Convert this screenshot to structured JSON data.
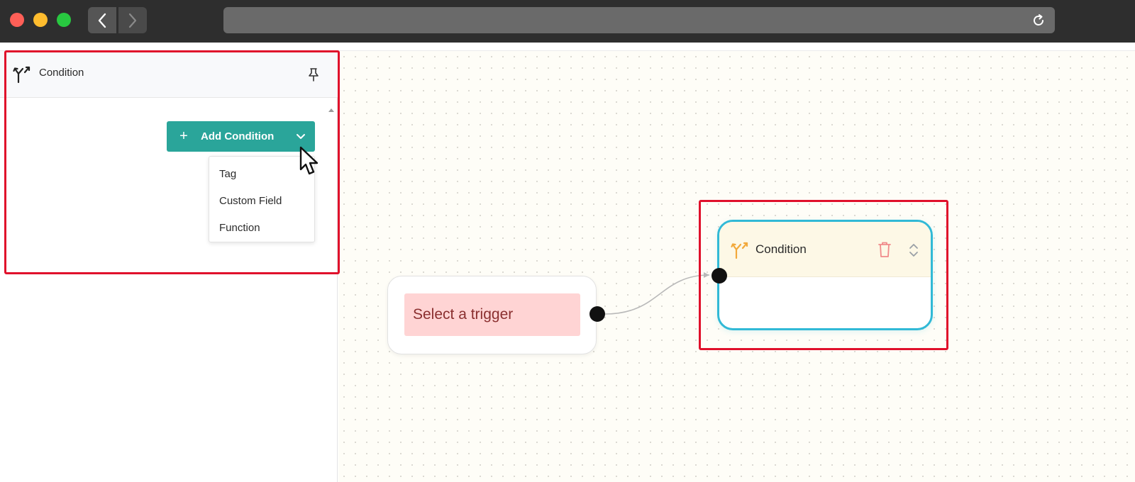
{
  "window": {
    "controls": [
      "close",
      "minimize",
      "zoom"
    ],
    "nav": {
      "back_icon": "chevron-left-icon",
      "forward_icon": "chevron-right-icon"
    },
    "address": {
      "value": "",
      "reload_icon": "reload-icon"
    }
  },
  "sidebar": {
    "header": {
      "icon": "branch-split-icon",
      "title": "Condition",
      "pin_icon": "pin-icon"
    },
    "add_button": {
      "plus": "+",
      "label": "Add Condition",
      "chevron_icon": "chevron-down-icon"
    },
    "menu": {
      "items": [
        "Tag",
        "Custom Field",
        "Function"
      ]
    }
  },
  "canvas": {
    "trigger_node": {
      "label": "Select a trigger"
    },
    "condition_node": {
      "icon": "branch-split-icon",
      "title": "Condition",
      "delete_icon": "trash-icon",
      "sort_icon": "chevron-up-down-icon"
    }
  },
  "colors": {
    "accent": "#2aa59a",
    "highlight": "#e0102b",
    "node_border": "#31b9d6",
    "trigger_bg": "#ffd4d4",
    "condition_icon": "#f2a93b",
    "trash": "#f08a8a"
  }
}
